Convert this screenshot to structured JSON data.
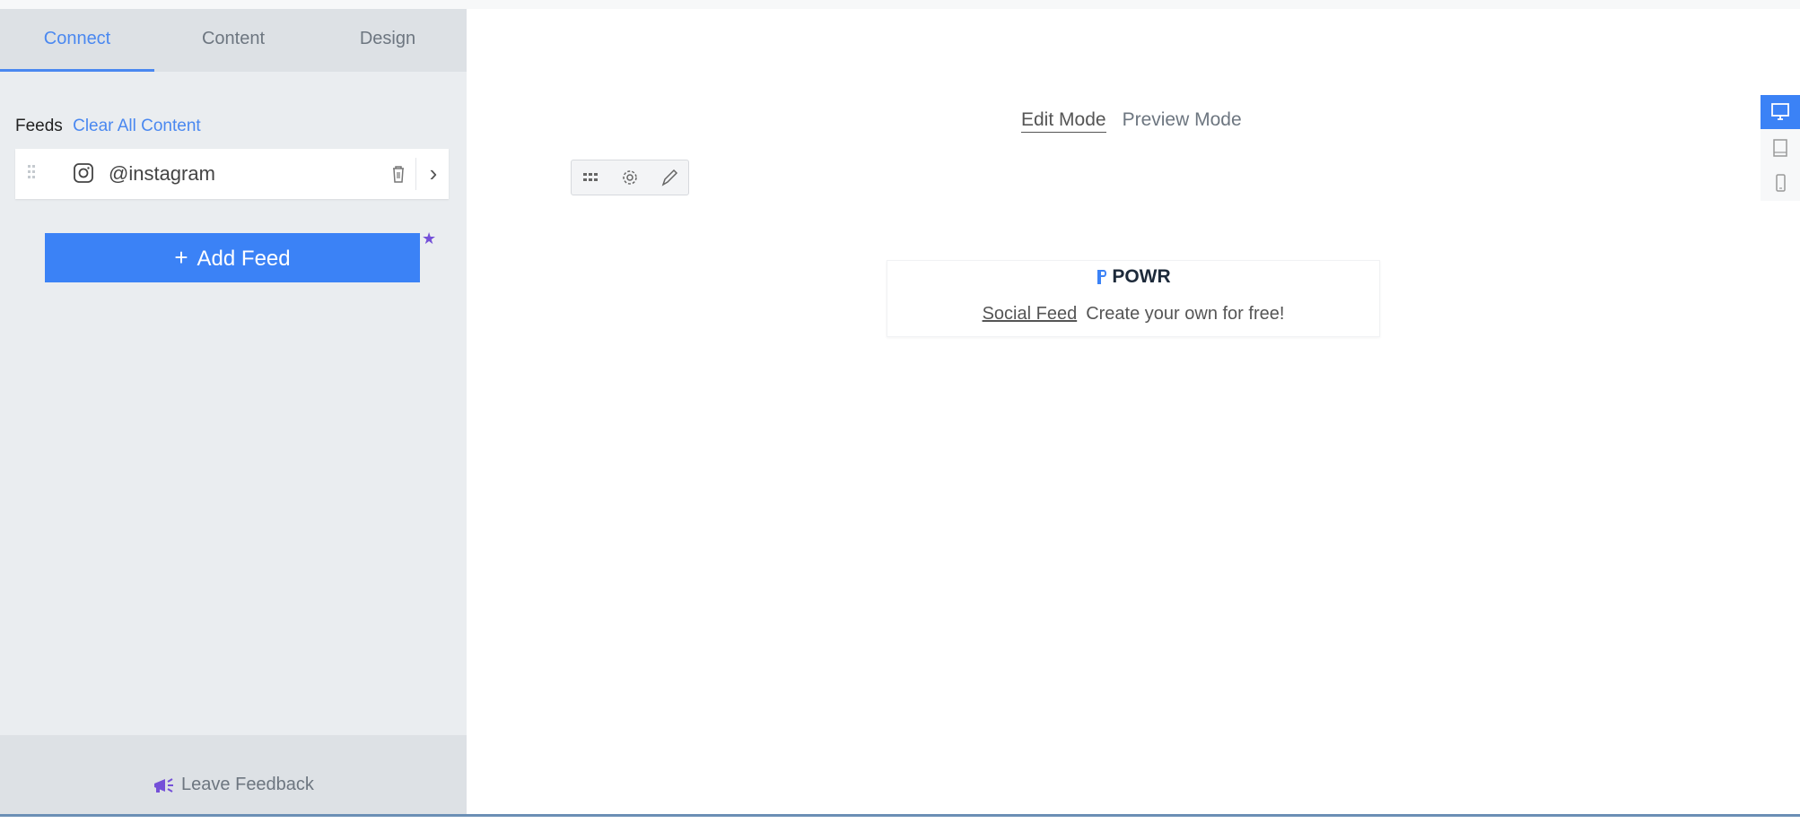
{
  "sidebar": {
    "tabs": [
      {
        "label": "Connect",
        "active": true
      },
      {
        "label": "Content",
        "active": false
      },
      {
        "label": "Design",
        "active": false
      }
    ],
    "feeds_label": "Feeds",
    "clear_all_label": "Clear All Content",
    "feed_items": [
      {
        "name": "@instagram",
        "icon": "instagram-icon"
      }
    ],
    "add_feed_label": "Add Feed",
    "feedback_label": "Leave Feedback"
  },
  "main": {
    "edit_mode_label": "Edit Mode",
    "preview_mode_label": "Preview Mode",
    "toolbar_icons": [
      "layout-icon",
      "gear-icon",
      "brush-icon"
    ],
    "branding": {
      "logo_text": "POWR",
      "product_label": "Social Feed",
      "cta_label": "Create your own for free!"
    },
    "devices": [
      "desktop-icon",
      "tablet-icon",
      "mobile-icon"
    ]
  },
  "colors": {
    "accent": "#3b82f6",
    "link": "#4a88f0",
    "premium_star": "#7450d8",
    "sidebar_bg": "#eaedf0"
  }
}
